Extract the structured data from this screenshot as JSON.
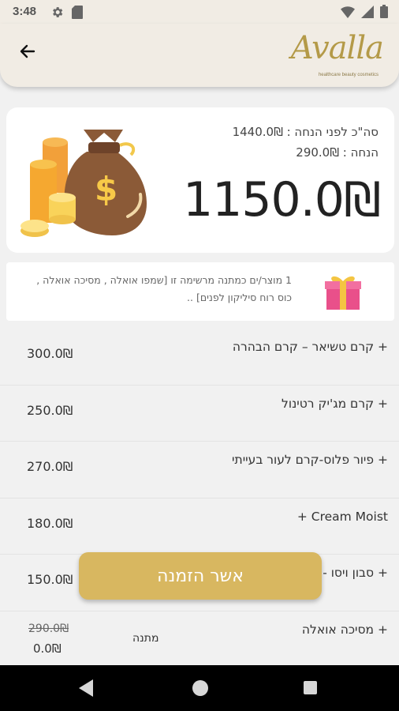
{
  "status_bar": {
    "time": "3:48",
    "icons": [
      "gear-icon",
      "sd-card-icon",
      "wifi-icon",
      "signal-icon",
      "battery-icon"
    ]
  },
  "app_bar": {
    "logo_text": "Avalla",
    "logo_tagline": "healthcare beauty cosmetics"
  },
  "summary": {
    "before_discount": "סה\"כ לפני הנחה : 1440.0₪",
    "discount": "הנחה : 290.0₪",
    "total": "1150.0₪"
  },
  "gift": {
    "text": "1 מוצר/ים כמתנה מרשימה זו [שמפו אואלה , מסיכה אואלה , כוס רוח סיליקון לפנים] .."
  },
  "items": [
    {
      "name": "+ קרם טשיאר – קרם הבהרה",
      "price": "300.0₪"
    },
    {
      "name": "+ קרם מג'יק רטינול",
      "price": "250.0₪"
    },
    {
      "name": "+ פיור פלוס-קרם לעור בעייתי",
      "price": "270.0₪"
    },
    {
      "name": "Cream Moist +",
      "price": "180.0₪"
    },
    {
      "name": "+ סבון ויסו -",
      "price": "150.0₪"
    },
    {
      "name": "+ מסיכה אואלה",
      "old_price": "290.0₪",
      "price": "0.0₪",
      "gift_label": "מתנה"
    }
  ],
  "confirm_button": "אשר הזמנה",
  "colors": {
    "accent": "#d8b760",
    "header_bg": "#f1ece4",
    "page_bg": "#f1f1f1"
  }
}
